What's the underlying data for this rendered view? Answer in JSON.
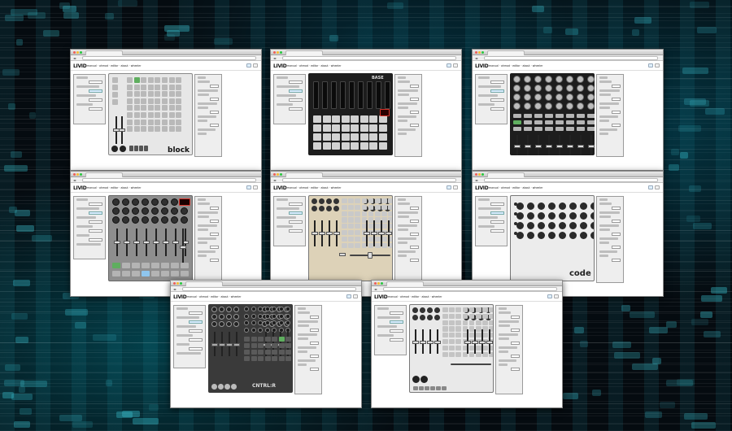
{
  "app": {
    "logo": "LIVID",
    "menu": "manual   ·   ohmod   ·   editor   ·   about   ·   wheeler"
  },
  "colors": {
    "accent_green": "#5fae5f",
    "accent_blue": "#8fc6ee",
    "display_red": "#d9342b",
    "ohm_tan": "#ddd2b8",
    "dark_device": "#1d1d1d"
  },
  "windows": [
    {
      "id": "block",
      "device_brand": "block",
      "device_style": "light"
    },
    {
      "id": "base",
      "device_brand": "BASE",
      "device_style": "dark-faders"
    },
    {
      "id": "alias8",
      "device_brand": "",
      "device_style": "dark-knobs"
    },
    {
      "id": "ds1",
      "device_brand": "",
      "device_style": "gray-mixer"
    },
    {
      "id": "ohm64",
      "device_brand": "",
      "device_style": "tan"
    },
    {
      "id": "code",
      "device_brand": "code",
      "device_style": "light-encoders"
    },
    {
      "id": "cntrlr",
      "device_brand": "CNTRL:R",
      "device_style": "dark-pads"
    },
    {
      "id": "ohmrgb",
      "device_brand": "",
      "device_style": "light-grid"
    }
  ]
}
